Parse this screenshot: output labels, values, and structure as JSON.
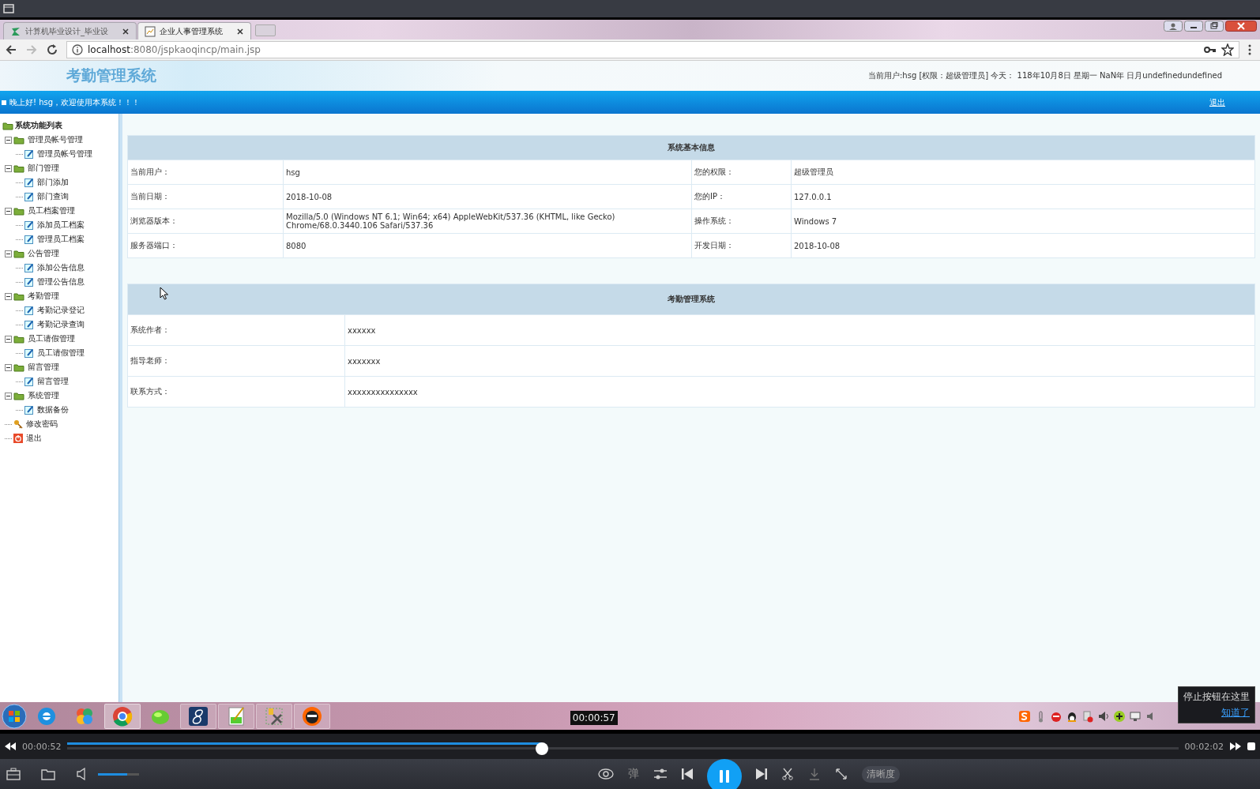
{
  "browser": {
    "tabs": [
      {
        "label": "计算机毕业设计_毕业设",
        "selected": false
      },
      {
        "label": "企业人事管理系统",
        "selected": true
      }
    ],
    "url_host": "localhost",
    "url_rest": ":8080/jspkaoqincp/main.jsp"
  },
  "page": {
    "header_title": "考勤管理系统",
    "user_info": "当前用户:hsg [权限：超级管理员] 今天： 118年10月8日 星期一 NaN年 日月undefinedundefined",
    "greeting": "晚上好! hsg，欢迎使用本系统！！！",
    "logout": "退出"
  },
  "tree": {
    "root": "系统功能列表",
    "children": [
      {
        "kind": "folder",
        "label": "管理员帐号管理",
        "expanded": true,
        "children": [
          {
            "kind": "page",
            "label": "管理员帐号管理"
          }
        ]
      },
      {
        "kind": "folder",
        "label": "部门管理",
        "expanded": true,
        "children": [
          {
            "kind": "page",
            "label": "部门添加"
          },
          {
            "kind": "page",
            "label": "部门查询"
          }
        ]
      },
      {
        "kind": "folder",
        "label": "员工档案管理",
        "expanded": true,
        "children": [
          {
            "kind": "page",
            "label": "添加员工档案"
          },
          {
            "kind": "page",
            "label": "管理员工档案"
          }
        ]
      },
      {
        "kind": "folder",
        "label": "公告管理",
        "expanded": true,
        "children": [
          {
            "kind": "page",
            "label": "添加公告信息"
          },
          {
            "kind": "page",
            "label": "管理公告信息"
          }
        ]
      },
      {
        "kind": "folder",
        "label": "考勤管理",
        "expanded": true,
        "children": [
          {
            "kind": "page",
            "label": "考勤记录登记"
          },
          {
            "kind": "page",
            "label": "考勤记录查询"
          }
        ]
      },
      {
        "kind": "folder",
        "label": "员工请假管理",
        "expanded": true,
        "children": [
          {
            "kind": "page",
            "label": "员工请假管理"
          }
        ]
      },
      {
        "kind": "folder",
        "label": "留言管理",
        "expanded": true,
        "children": [
          {
            "kind": "page",
            "label": "留言管理"
          }
        ]
      },
      {
        "kind": "folder",
        "label": "系统管理",
        "expanded": true,
        "children": [
          {
            "kind": "page",
            "label": "数据备份"
          }
        ]
      },
      {
        "kind": "key",
        "label": "修改密码"
      },
      {
        "kind": "exit",
        "label": "退出"
      }
    ]
  },
  "info_table": {
    "title": "系统基本信息",
    "rows": [
      [
        "当前用户：",
        "hsg",
        "您的权限：",
        "超级管理员"
      ],
      [
        "当前日期：",
        "2018-10-08",
        "您的IP：",
        "127.0.0.1"
      ],
      [
        "浏览器版本：",
        "Mozilla/5.0 (Windows NT 6.1; Win64; x64) AppleWebKit/537.36 (KHTML, like Gecko) Chrome/68.0.3440.106 Safari/537.36",
        "操作系统：",
        "Windows 7"
      ],
      [
        "服务器端口：",
        "8080",
        "开发日期：",
        "2018-10-08"
      ]
    ]
  },
  "about_table": {
    "title": "考勤管理系统",
    "rows": [
      [
        "系统作者：",
        "xxxxxx"
      ],
      [
        "指导老师：",
        "xxxxxxx"
      ],
      [
        "联系方式：",
        "xxxxxxxxxxxxxxx"
      ]
    ]
  },
  "player": {
    "current_time": "00:00:52",
    "total_time": "00:02:02",
    "hover_time": "00:00:57",
    "level": 0.427,
    "playing": true,
    "volume": {
      "level": 0.71
    },
    "danmaku": "弹",
    "quality": "清晰度",
    "tip": {
      "text": "停止按钮在这里",
      "link": "知道了"
    }
  }
}
